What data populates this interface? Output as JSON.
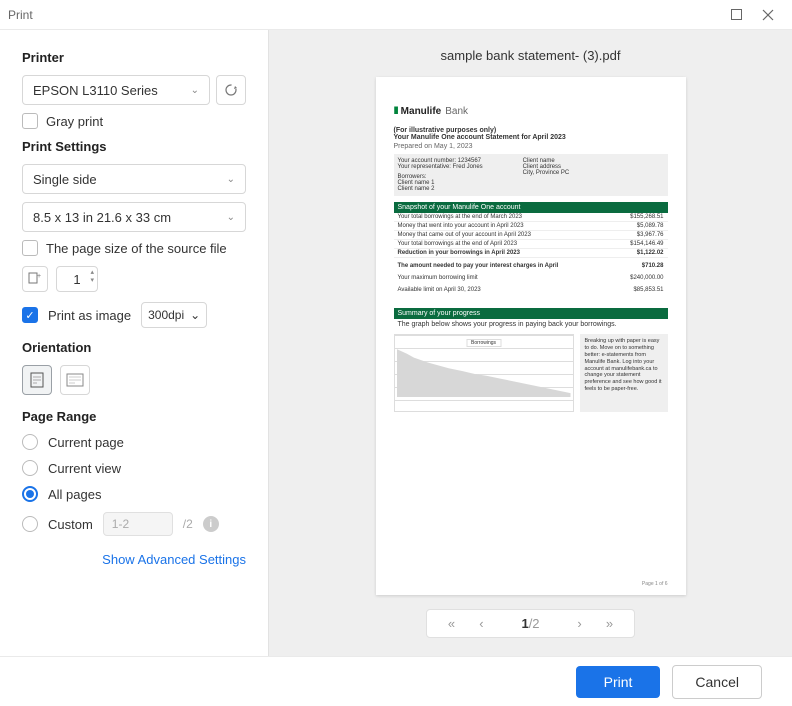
{
  "title": "Print",
  "sections": {
    "printer": "Printer",
    "print_settings": "Print Settings",
    "orientation": "Orientation",
    "page_range": "Page Range"
  },
  "printer": {
    "selected": "EPSON L3110 Series",
    "gray_print": "Gray print"
  },
  "settings": {
    "sides": "Single side",
    "paper": "8.5 x 13 in 21.6 x 33 cm",
    "source_size_label": "The page size of the source file",
    "copies": "1",
    "print_as_image": "Print as image",
    "dpi": "300dpi"
  },
  "page_range": {
    "current_page": "Current page",
    "current_view": "Current view",
    "all_pages": "All pages",
    "custom": "Custom",
    "custom_placeholder": "1-2",
    "total": "/2"
  },
  "advanced": "Show Advanced Settings",
  "preview": {
    "filename": "sample bank statement- (3).pdf",
    "current_page": "1",
    "total_pages": "/2"
  },
  "doc": {
    "brand": "Manulife",
    "brand_sub": "Bank",
    "illus": "(For illustrative purposes only)",
    "doc_title": "Your Manulife One account Statement for April 2023",
    "prepared": "Prepared on May 1, 2023",
    "acct_left": {
      "l1": "Your account number: 1234567",
      "l2": "Your representative: Fred Jones",
      "l3": "Borrowers:",
      "l4": "Client name 1",
      "l5": "Client name 2"
    },
    "acct_right": {
      "l1": "Client name",
      "l2": "Client address",
      "l3": "City, Province PC"
    },
    "snapshot_header": "Snapshot of your Manulife One account",
    "rows": [
      [
        "Your total borrowings at the end of March 2023",
        "$155,268.51"
      ],
      [
        "Money that went into your account in April 2023",
        "$5,089.78"
      ],
      [
        "Money that came out of your account in April 2023",
        "$3,967.76"
      ],
      [
        "Your total borrowings at the end of April 2023",
        "$154,146.49"
      ],
      [
        "Reduction in your borrowings in April 2023",
        "$1,122.02"
      ],
      [
        "The amount needed to pay your interest charges in April",
        "$710.28"
      ],
      [
        "Your maximum borrowing limit",
        "$240,000.00"
      ],
      [
        "Available limit on April 30, 2023",
        "$85,853.51"
      ]
    ],
    "summary_header": "Summary of your progress",
    "summary_sub": "The graph below shows your progress in paying back your borrowings.",
    "chart_label": "Borrowings",
    "aside": "Breaking up with paper is easy to do. Move on to something better: e-statements from Manulife Bank. Log into your account at manulifebank.ca to change your statement preference and see how good it feels to be paper-free.",
    "page_footer": "Page 1 of 6"
  },
  "buttons": {
    "print": "Print",
    "cancel": "Cancel"
  }
}
